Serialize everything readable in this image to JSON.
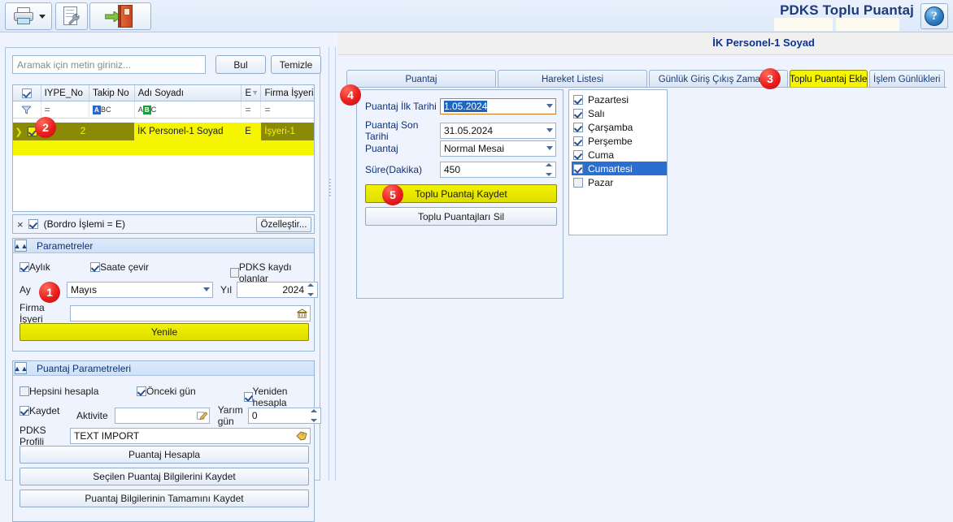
{
  "app": {
    "title": "PDKS Toplu Puantaj",
    "subheader_name": "İK Personel-1 Soyad",
    "help_glyph": "?"
  },
  "toolbar": {
    "print_icon": "printer-icon",
    "print_dropdown_icon": "caret-down-icon",
    "report_designer_icon": "document-wrench-icon",
    "exit_icon": "exit-door-icon"
  },
  "left": {
    "search": {
      "placeholder": "Aramak için metin giriniz...",
      "value": "",
      "find_label": "Bul",
      "clear_label": "Temizle"
    },
    "grid": {
      "columns": [
        "IYPE_No",
        "Takip No",
        "Adı Soyadı",
        "E",
        "Firma İşyeri"
      ],
      "filter_row": [
        "=",
        "ABC",
        "ABC",
        "=",
        "="
      ],
      "rows": [
        {
          "selected": true,
          "checked": true,
          "iype_no": "2",
          "takip_no": "",
          "adi_soyadi": "İK Personel-1 Soyad",
          "e": "E",
          "firma_isyeri": "İşyeri-1"
        }
      ]
    },
    "filterbar": {
      "close_glyph": "×",
      "checked": true,
      "expression": "(Bordro İşlemi = E)",
      "customize_label": "Özelleştir..."
    },
    "parametreler": {
      "title": "Parametreler",
      "collapse_glyph": "«",
      "aylik": {
        "label": "Aylık",
        "checked": true
      },
      "saate_cevir": {
        "label": "Saate çevir",
        "checked": true
      },
      "pdks_kaydi": {
        "label": "PDKS kaydı olanlar",
        "checked": false
      },
      "ay_label": "Ay",
      "ay_value": "Mayıs",
      "yil_label": "Yıl",
      "yil_value": "2024",
      "firma_isyeri_label": "Firma İşyeri",
      "firma_isyeri_value": "",
      "refresh_label": "Yenile"
    },
    "puantaj_parametreleri": {
      "title": "Puantaj Parametreleri",
      "collapse_glyph": "«",
      "hepsini_hesapla": {
        "label": "Hepsini hesapla",
        "checked": false
      },
      "onceki_gun": {
        "label": "Önceki gün",
        "checked": true
      },
      "yeniden_hesapla": {
        "label": "Yeniden hesapla",
        "checked": true
      },
      "kaydet": {
        "label": "Kaydet",
        "checked": true
      },
      "aktivite_label": "Aktivite",
      "aktivite_value": "",
      "yarim_gun_label": "Yarım gün",
      "yarim_gun_value": "0",
      "pdks_profili_label": "PDKS Profili",
      "pdks_profili_value": "TEXT IMPORT",
      "btn_hesapla": "Puantaj Hesapla",
      "btn_secilen_kaydet": "Seçilen Puantaj Bilgilerini Kaydet",
      "btn_tamamini_kaydet": "Puantaj Bilgilerinin Tamamını Kaydet"
    }
  },
  "right": {
    "tabs": [
      {
        "label": "Puantaj",
        "active": false
      },
      {
        "label": "Hareket Listesi",
        "active": false
      },
      {
        "label": "Günlük Giriş Çıkış Zamanları",
        "active": false
      },
      {
        "label": "Toplu Puantaj Ekle",
        "active": true
      },
      {
        "label": "İşlem Günlükleri",
        "active": false
      }
    ],
    "form": {
      "ilk_tarih_label": "Puantaj İlk Tarihi",
      "ilk_tarih_value": "1.05.2024",
      "son_tarih_label": "Puantaj Son Tarihi",
      "son_tarih_value": "31.05.2024",
      "puantaj_label": "Puantaj",
      "puantaj_value": "Normal Mesai",
      "sure_label": "Süre(Dakika)",
      "sure_value": "450",
      "btn_kaydet": "Toplu Puantaj Kaydet",
      "btn_sil": "Toplu Puantajları Sil"
    },
    "days": [
      {
        "label": "Pazartesi",
        "checked": true,
        "selected": false
      },
      {
        "label": "Salı",
        "checked": true,
        "selected": false
      },
      {
        "label": "Çarşamba",
        "checked": true,
        "selected": false
      },
      {
        "label": "Perşembe",
        "checked": true,
        "selected": false
      },
      {
        "label": "Cuma",
        "checked": true,
        "selected": false
      },
      {
        "label": "Cumartesi",
        "checked": true,
        "selected": true
      },
      {
        "label": "Pazar",
        "checked": false,
        "selected": false
      }
    ]
  },
  "badges": [
    {
      "num": "1"
    },
    {
      "num": "2"
    },
    {
      "num": "3"
    },
    {
      "num": "4"
    },
    {
      "num": "5"
    }
  ],
  "colors": {
    "highlight_yellow": "#f5f500",
    "olive": "#8a8a06",
    "accent_blue": "#1f66c2",
    "badge_red": "#e81f1f",
    "title_navy": "#1e3a7a"
  }
}
